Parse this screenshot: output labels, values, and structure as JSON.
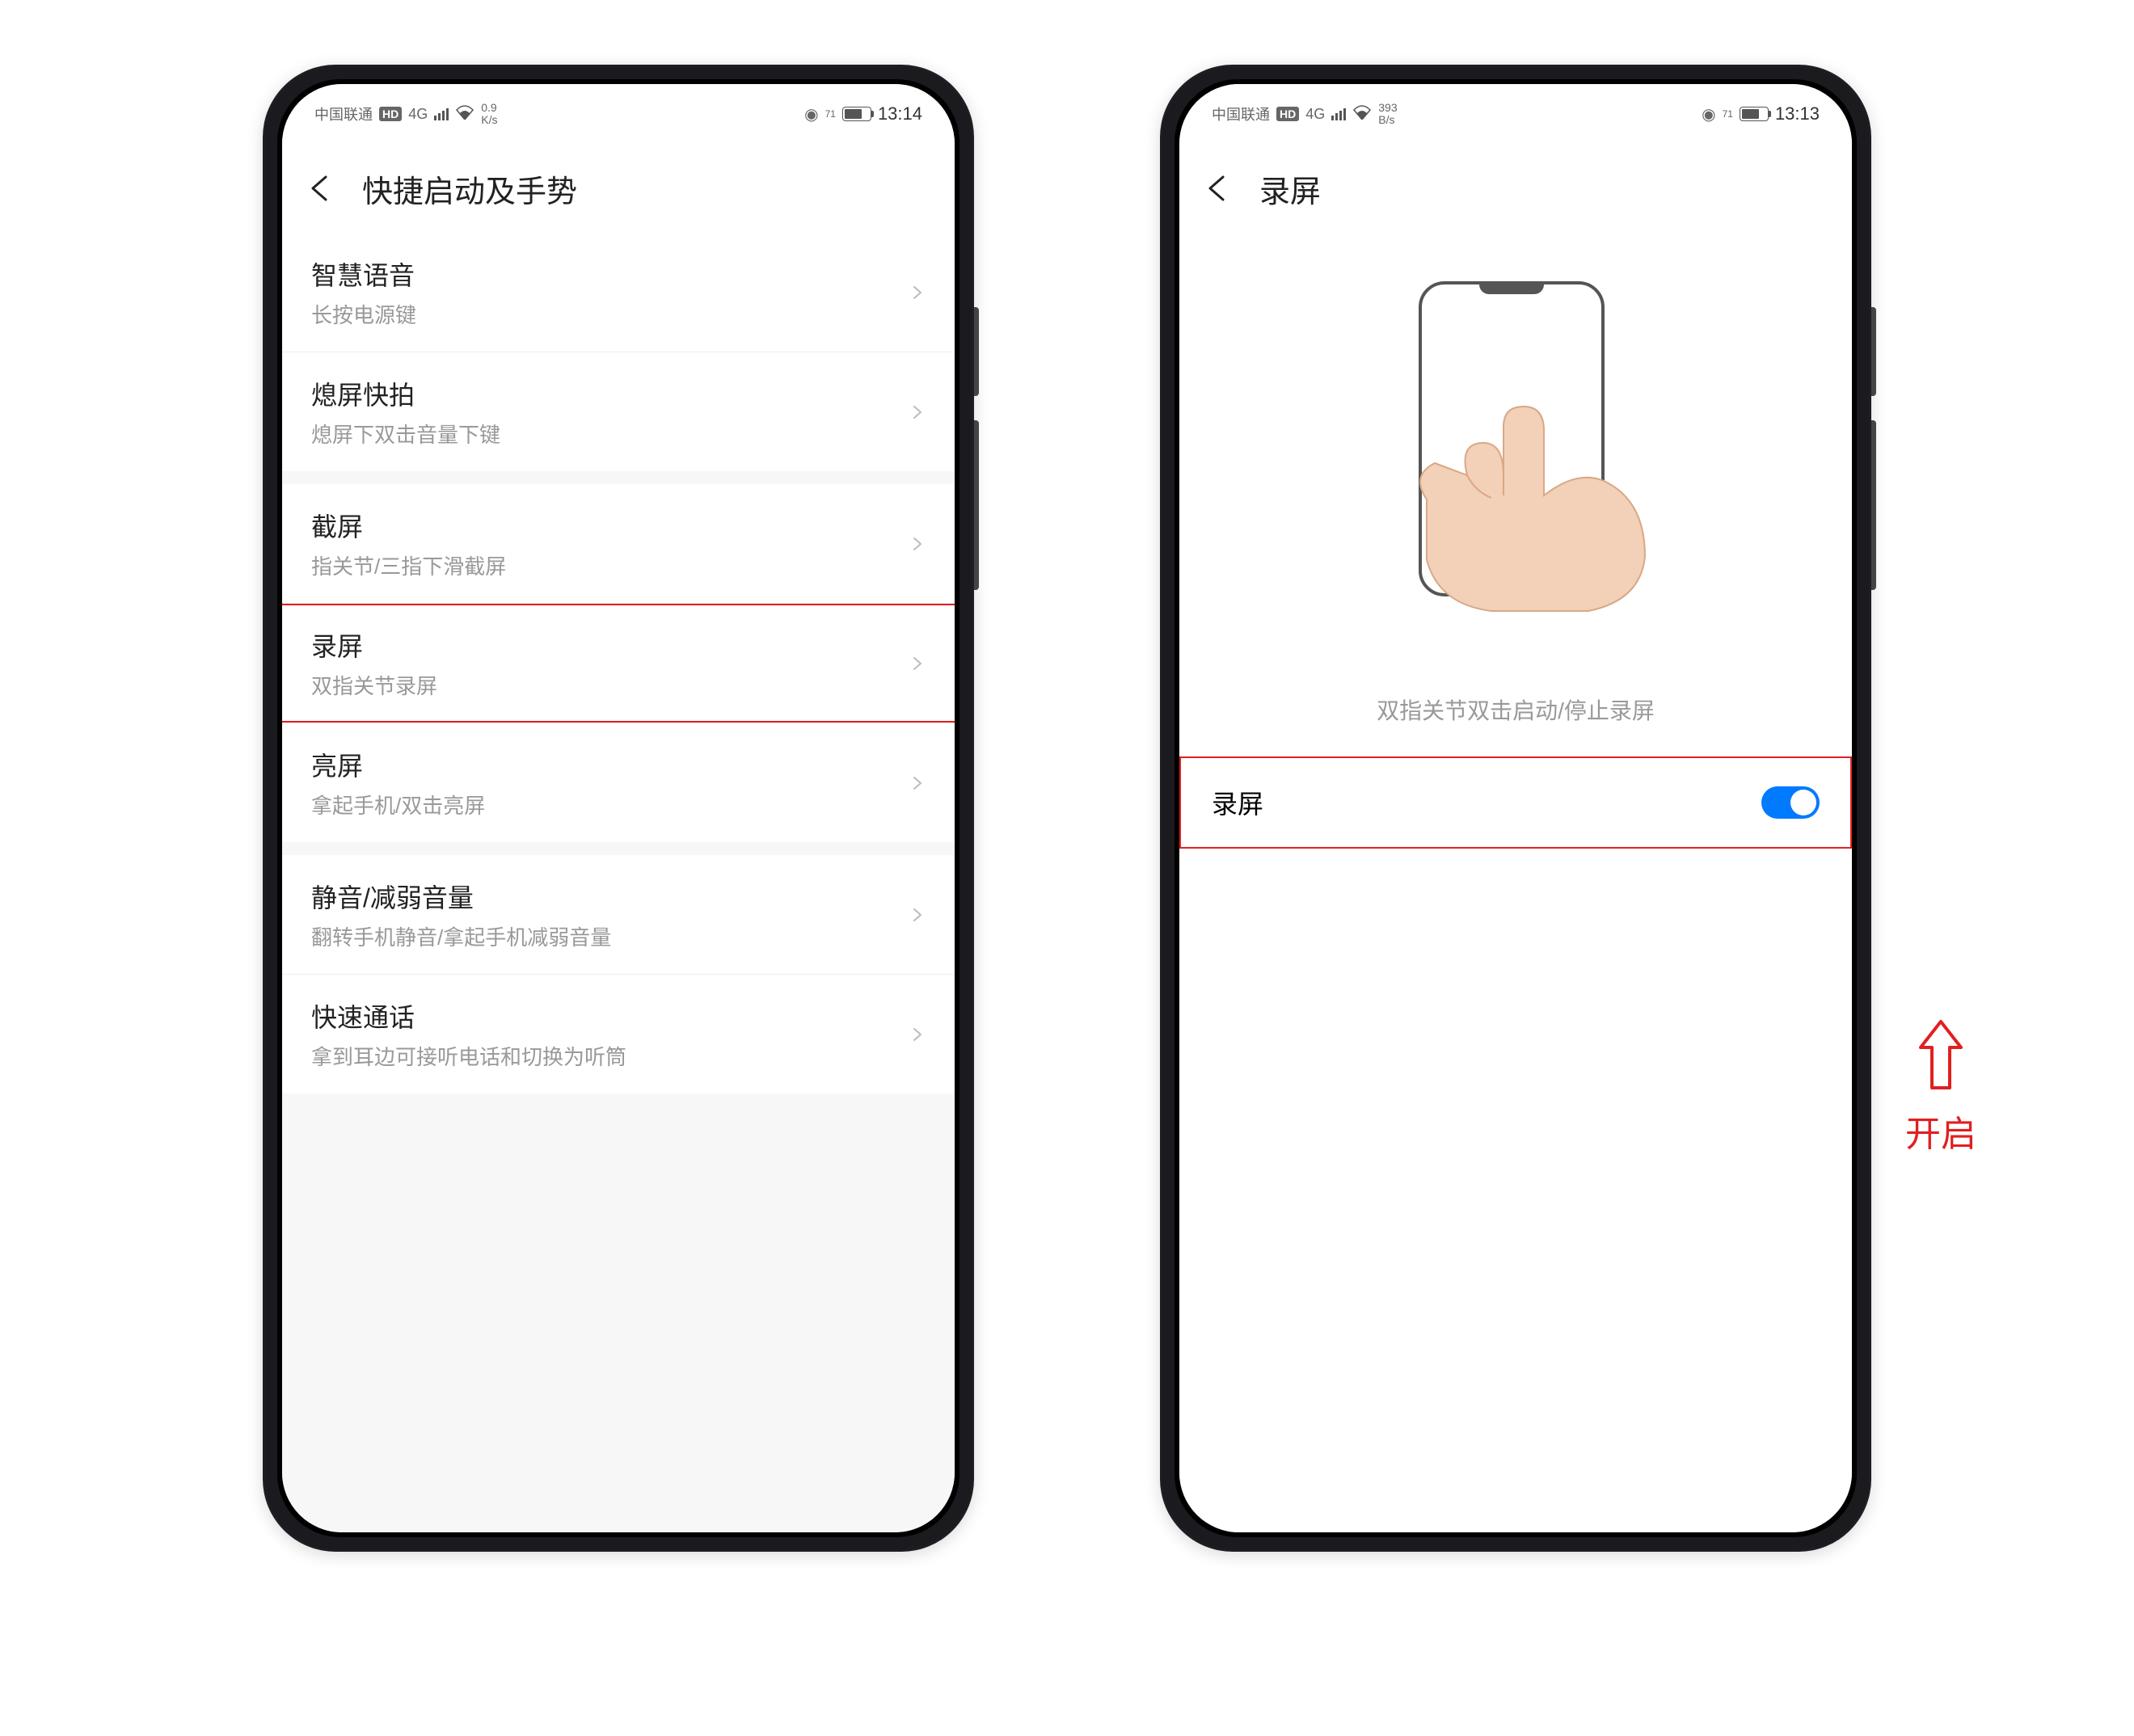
{
  "phone1": {
    "status": {
      "carrier": "中国联通",
      "hd": "HD",
      "net": "4G",
      "speed_top": "0.9",
      "speed_bottom": "K/s",
      "battery_pct": "71",
      "time": "13:14"
    },
    "header": {
      "title": "快捷启动及手势"
    },
    "groups": [
      [
        {
          "title": "智慧语音",
          "subtitle": "长按电源键"
        },
        {
          "title": "熄屏快拍",
          "subtitle": "熄屏下双击音量下键"
        }
      ],
      [
        {
          "title": "截屏",
          "subtitle": "指关节/三指下滑截屏"
        },
        {
          "title": "录屏",
          "subtitle": "双指关节录屏",
          "highlight": true
        },
        {
          "title": "亮屏",
          "subtitle": "拿起手机/双击亮屏"
        }
      ],
      [
        {
          "title": "静音/减弱音量",
          "subtitle": "翻转手机静音/拿起手机减弱音量"
        },
        {
          "title": "快速通话",
          "subtitle": "拿到耳边可接听电话和切换为听筒"
        }
      ]
    ]
  },
  "phone2": {
    "status": {
      "carrier": "中国联通",
      "hd": "HD",
      "net": "4G",
      "speed_top": "393",
      "speed_bottom": "B/s",
      "battery_pct": "71",
      "time": "13:13"
    },
    "header": {
      "title": "录屏"
    },
    "instruction": "双指关节双击启动/停止录屏",
    "toggle": {
      "label": "录屏",
      "on": true
    }
  },
  "annotation": "开启"
}
